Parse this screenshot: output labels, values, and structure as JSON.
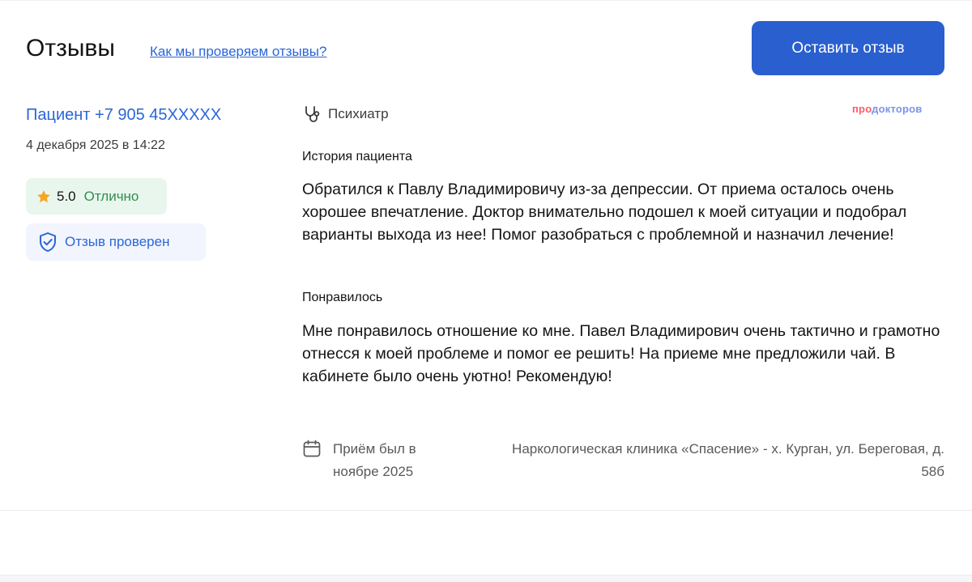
{
  "header": {
    "title": "Отзывы",
    "check_link": "Как мы проверяем отзывы?",
    "leave_button": "Оставить отзыв"
  },
  "review": {
    "author": "Пациент +7 905 45XXXXX",
    "date": "4 декабря 2025 в 14:22",
    "rating_value": "5.0",
    "rating_word": "Отлично",
    "verified": "Отзыв проверен",
    "specialty": "Психиатр",
    "brand": {
      "part1": "про",
      "part2": "докторов"
    },
    "story_heading": "История пациента",
    "story_text": "Обратился к Павлу Владимировичу из-за депрессии. От приема осталось очень хорошее впечатление. Доктор внимательно подошел к моей ситуации и подобрал варианты выхода из нее! Помог разобраться с проблемной и назначил лечение!",
    "liked_heading": "Понравилось",
    "liked_text": "Мне понравилось отношение ко мне. Павел Владимирович очень тактично и грамотно отнесся к моей проблеме и помог ее решить! На приеме мне предложили чай. В кабинете было очень уютно! Рекомендую!",
    "visit_text": "Приём был в ноябре  2025",
    "clinic": "Наркологическая клиника «Спасение» - х. Курган, ул. Береговая, д. 58б"
  },
  "icons": {
    "star": "star-icon",
    "shield": "shield-check-icon",
    "stethoscope": "stethoscope-icon",
    "calendar": "calendar-icon"
  },
  "colors": {
    "accent": "#2a5fcf",
    "link": "#2a66d8",
    "rating_green": "#2f8f4e",
    "star": "#f5a623"
  }
}
